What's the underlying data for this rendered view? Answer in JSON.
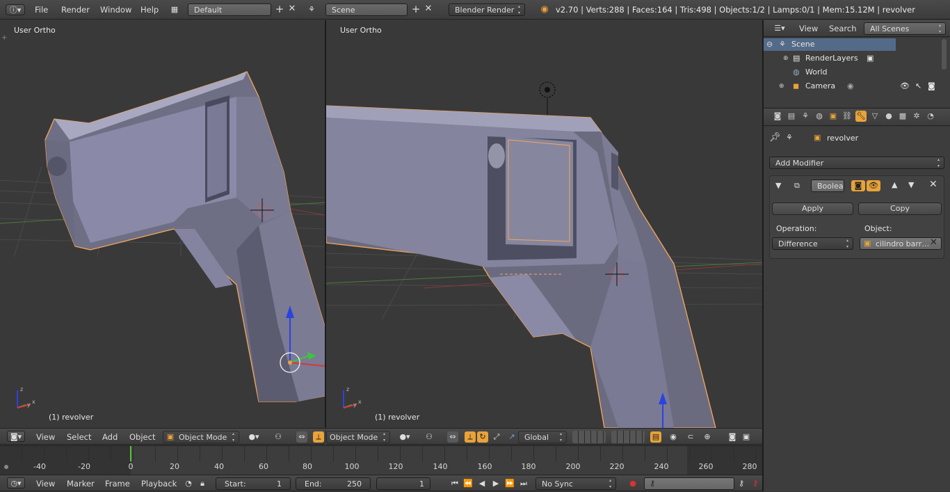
{
  "topbar": {
    "menus": [
      "File",
      "Render",
      "Window",
      "Help"
    ],
    "layout_name": "Default",
    "scene_name": "Scene",
    "render_engine": "Blender Render",
    "stats": "v2.70 | Verts:288 | Faces:164 | Tris:498 | Objects:1/2 | Lamps:0/1 | Mem:15.12M | revolver"
  },
  "viewport_left": {
    "label": "User Ortho",
    "object_label": "(1) revolver"
  },
  "viewport_right": {
    "label": "User Ortho",
    "object_label": "(1) revolver"
  },
  "view3d_header_left": {
    "menus": [
      "View",
      "Select",
      "Add",
      "Object"
    ],
    "mode": "Object Mode"
  },
  "view3d_header_right": {
    "mode": "Object Mode",
    "orientation": "Global"
  },
  "outliner": {
    "menus": [
      "View",
      "Search"
    ],
    "filter": "All Scenes",
    "items": [
      "Scene",
      "RenderLayers",
      "World",
      "Camera"
    ]
  },
  "properties": {
    "object_name": "revolver",
    "add_modifier": "Add Modifier",
    "modifier_name": "Boolea",
    "apply_label": "Apply",
    "copy_label": "Copy",
    "operation_label": "Operation:",
    "operation_value": "Difference",
    "object_label": "Object:",
    "object_value": "cilindro barr…"
  },
  "timeline": {
    "ticks": [
      "-40",
      "-20",
      "0",
      "20",
      "40",
      "60",
      "80",
      "100",
      "120",
      "140",
      "160",
      "180",
      "200",
      "220",
      "240",
      "260",
      "280"
    ],
    "menus": [
      "View",
      "Marker",
      "Frame",
      "Playback"
    ],
    "start_label": "Start:",
    "start_value": "1",
    "end_label": "End:",
    "end_value": "250",
    "current_frame": "1",
    "sync": "No Sync"
  },
  "colors": {
    "background": "#393939",
    "header": "#474747",
    "selection_outline": "#f7a75a",
    "accent_orange": "#e8a33a",
    "current_frame_marker": "#5cc43a"
  }
}
